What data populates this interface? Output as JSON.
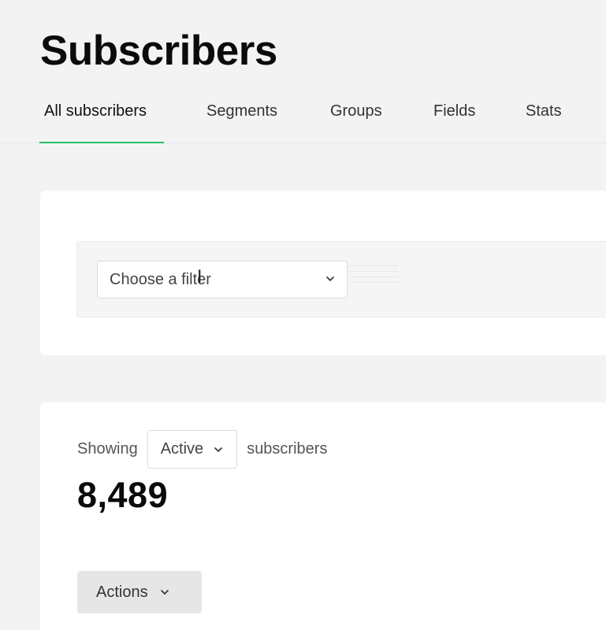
{
  "header": {
    "title": "Subscribers"
  },
  "tabs": [
    {
      "label": "All subscribers",
      "active": true
    },
    {
      "label": "Segments"
    },
    {
      "label": "Groups"
    },
    {
      "label": "Fields"
    },
    {
      "label": "Stats"
    }
  ],
  "filter": {
    "select_value": "Choose a filter",
    "chevron_icon": "chevron-down-icon"
  },
  "subscribers": {
    "showing_prefix": "Showing",
    "status_value": "Active",
    "showing_suffix": "subscribers",
    "count": "8,489"
  },
  "toolbar": {
    "actions_label": "Actions"
  },
  "colors": {
    "accent": "#21c16b",
    "background": "#f3f3f3",
    "card": "#ffffff"
  }
}
